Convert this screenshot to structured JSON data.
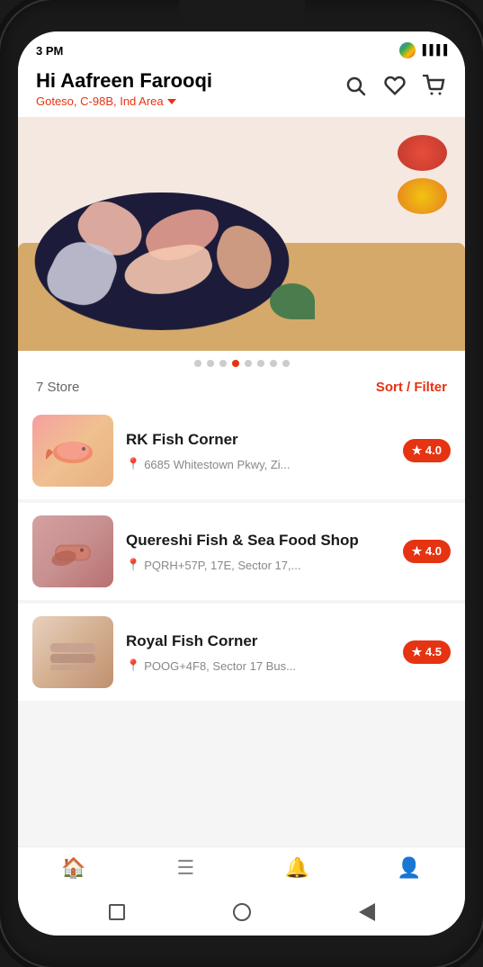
{
  "status_bar": {
    "time": "3 PM",
    "network": "4G+"
  },
  "header": {
    "greeting": "Hi Aafreen Farooqi",
    "location": "Goteso, C-98B, Ind Area",
    "search_icon": "search",
    "heart_icon": "heart",
    "cart_icon": "shopping-cart"
  },
  "banner": {
    "dots_count": 8,
    "active_dot": 4
  },
  "store_bar": {
    "count_label": "7 Store",
    "sort_label": "Sort / Filter"
  },
  "stores": [
    {
      "name": "RK Fish Corner",
      "address": "6685 Whitestown Pkwy, Zi...",
      "rating": "★ 4.0",
      "thumb_class": "thumb-fish1"
    },
    {
      "name": "Quereshi Fish & Sea Food Shop",
      "address": "PQRH+57P, 17E, Sector 17,...",
      "rating": "★ 4.0",
      "thumb_class": "thumb-fish2"
    },
    {
      "name": "Royal Fish Corner",
      "address": "POOG+4F8, Sector 17 Bus...",
      "rating": "★ 4.5",
      "thumb_class": "thumb-fish3"
    }
  ],
  "bottom_nav": [
    {
      "icon": "🏠",
      "label": "home",
      "active": true
    },
    {
      "icon": "☰",
      "label": "menu",
      "active": false
    },
    {
      "icon": "🔔",
      "label": "notifications",
      "active": false
    },
    {
      "icon": "👤",
      "label": "profile",
      "active": false
    }
  ]
}
